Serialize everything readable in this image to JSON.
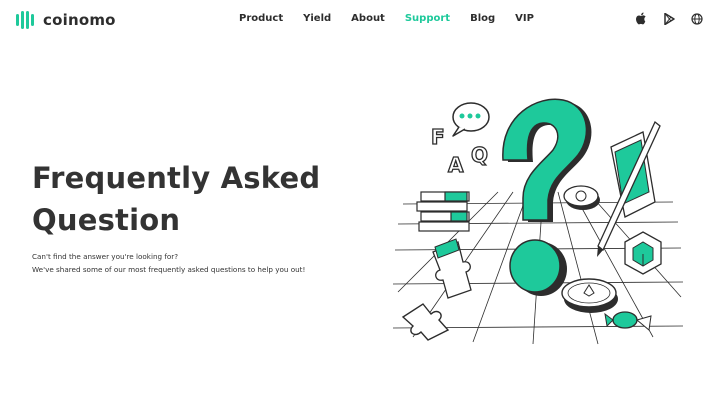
{
  "brand": {
    "name": "coinomo",
    "accent": "#1ec99b",
    "dark": "#2d2d2d"
  },
  "nav": {
    "items": [
      {
        "label": "Product",
        "active": false
      },
      {
        "label": "Yield",
        "active": false
      },
      {
        "label": "About",
        "active": false
      },
      {
        "label": "Support",
        "active": true
      },
      {
        "label": "Blog",
        "active": false
      },
      {
        "label": "VIP",
        "active": false
      }
    ]
  },
  "header_icons": [
    "apple-icon",
    "google-play-icon",
    "globe-icon"
  ],
  "hero": {
    "title_line1": "Frequently Asked",
    "title_line2": "Question",
    "subtitle_line1": "Can't find the answer you're looking for?",
    "subtitle_line2": "We've shared some of our most frequently asked questions to help you out!"
  },
  "illustration": {
    "letters": [
      "F",
      "A",
      "Q"
    ]
  }
}
